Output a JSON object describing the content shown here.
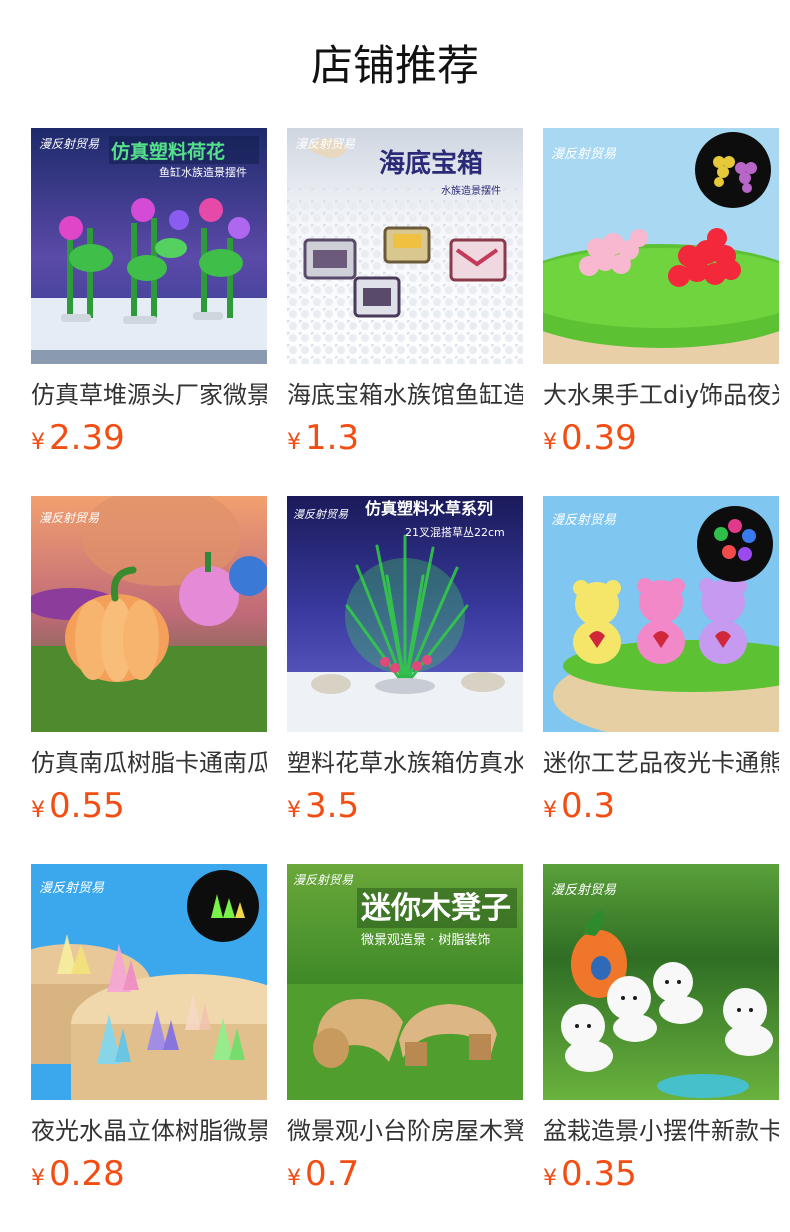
{
  "section_title": "店铺推荐",
  "currency_symbol": "¥",
  "products": [
    {
      "name": "仿真草堆源头厂家微景观鱼缸造景",
      "price": "2.39",
      "banner": "仿真塑料荷花",
      "sub": "鱼缸水族造景摆件",
      "brand": "漫反射贸易"
    },
    {
      "name": "海底宝箱水族馆鱼缸造景摆件",
      "price": "1.3",
      "banner": "海底宝箱",
      "sub": "水族造景摆件",
      "brand": "漫反射贸易"
    },
    {
      "name": "大水果手工diy饰品夜光葡萄",
      "price": "0.39",
      "banner": "",
      "sub": "",
      "brand": "漫反射贸易"
    },
    {
      "name": "仿真南瓜树脂卡通南瓜摆件",
      "price": "0.55",
      "banner": "",
      "sub": "",
      "brand": "漫反射贸易"
    },
    {
      "name": "塑料花草水族箱仿真水草造景",
      "price": "3.5",
      "banner": "仿真塑料水草系列",
      "sub": "21叉混搭草丛22cm",
      "brand": "漫反射贸易"
    },
    {
      "name": "迷你工艺品夜光卡通熊摆件",
      "price": "0.3",
      "banner": "",
      "sub": "",
      "brand": "漫反射贸易"
    },
    {
      "name": "夜光水晶立体树脂微景观摆件",
      "price": "0.28",
      "banner": "",
      "sub": "",
      "brand": "漫反射贸易"
    },
    {
      "name": "微景观小台阶房屋木凳子摆件",
      "price": "0.7",
      "banner": "迷你木凳子",
      "sub": "微景观造景 · 树脂装饰",
      "brand": "漫反射贸易"
    },
    {
      "name": "盆栽造景小摆件新款卡通小狗",
      "price": "0.35",
      "banner": "",
      "sub": "",
      "brand": "漫反射贸易"
    }
  ]
}
